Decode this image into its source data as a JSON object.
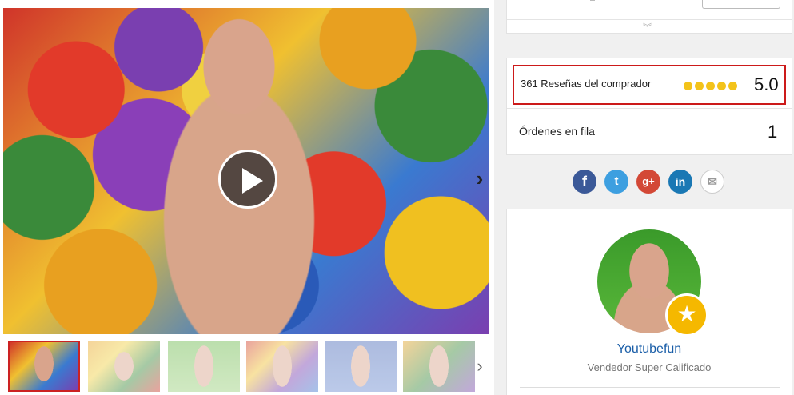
{
  "video": {
    "play_icon": "play-icon",
    "next_icon": "chevron-right-icon"
  },
  "thumbnails": {
    "count_visible": 6,
    "next_icon": "chevron-right-icon"
  },
  "stats": {
    "reviews_label": "361 Reseñas del comprador",
    "rating_value": "5.0",
    "stars": 5,
    "orders_label": "Órdenes en fila",
    "orders_value": "1"
  },
  "share": {
    "facebook": "f",
    "twitter": "t",
    "google": "g+",
    "linkedin": "in",
    "mail": "✉"
  },
  "seller": {
    "name": "Youtubefun",
    "tier": "Vendedor Super Calificado",
    "badge_icon": "star-icon"
  },
  "top_panel": {
    "expand_icon": "double-chevron-down-icon"
  },
  "colors": {
    "highlight_border": "#cc1a1a",
    "star": "#f3c31a",
    "seller_name": "#1a5ea8",
    "badge": "#f5b800"
  }
}
